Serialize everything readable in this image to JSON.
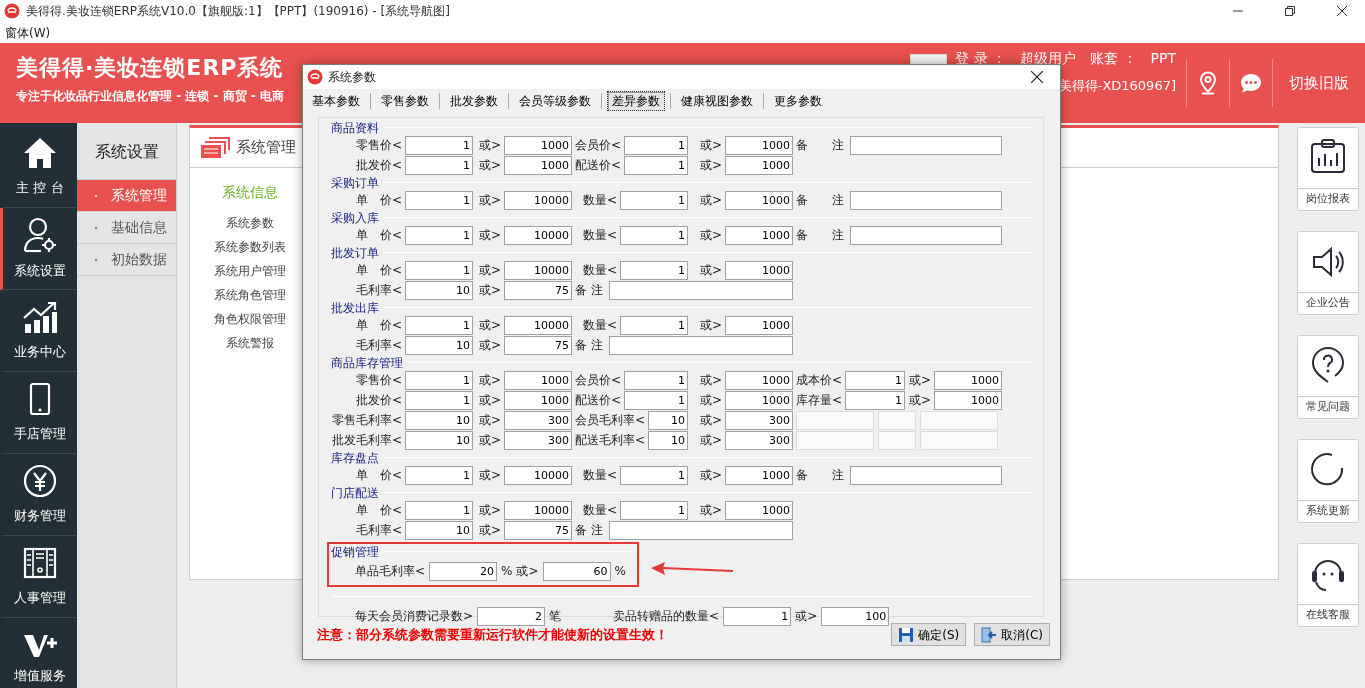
{
  "window": {
    "title": "美得得.美妆连锁ERP系统V10.0【旗舰版:1】【PPT】(190916) - [系统导航图]",
    "menu": [
      "窗体(W)"
    ]
  },
  "header": {
    "brand": "美得得·美妆连锁ERP系统",
    "slogan": "专注于化妆品行业信息化管理 - 连锁 - 商贸 - 电商",
    "login_label": "登 录 ：",
    "user": "超级用户",
    "account_label": "账套 ：",
    "account": "PPT",
    "account_code": "美得得-XD160967]",
    "switch_label": "切换旧版"
  },
  "nav": [
    {
      "label": "主 控 台",
      "selected": false
    },
    {
      "label": "系统设置",
      "selected": true
    },
    {
      "label": "业务中心",
      "selected": false
    },
    {
      "label": "手店管理",
      "selected": false
    },
    {
      "label": "财务管理",
      "selected": false
    },
    {
      "label": "人事管理",
      "selected": false
    },
    {
      "label": "增值服务",
      "selected": false
    }
  ],
  "submenu": {
    "title": "系统设置",
    "items": [
      {
        "label": "系统管理",
        "selected": true
      },
      {
        "label": "基础信息",
        "selected": false
      },
      {
        "label": "初始数据",
        "selected": false
      }
    ]
  },
  "panel": {
    "title": "系统管理",
    "group": "系统信息",
    "links": [
      "系统参数",
      "系统参数列表",
      "系统用户管理",
      "系统角色管理",
      "角色权限管理",
      "系统警报"
    ]
  },
  "shortcuts": [
    "岗位报表",
    "企业公告",
    "常见问题",
    "系统更新",
    "在线客服"
  ],
  "dialog": {
    "title": "系统参数",
    "tabs": [
      {
        "label": "基本参数",
        "selected": false
      },
      {
        "label": "零售参数",
        "selected": false
      },
      {
        "label": "批发参数",
        "selected": false
      },
      {
        "label": "会员等级参数",
        "selected": false
      },
      {
        "label": "差异参数",
        "selected": true
      },
      {
        "label": "健康视图参数",
        "selected": false
      },
      {
        "label": "更多参数",
        "selected": false
      }
    ],
    "sections": [
      {
        "title": "商品资料",
        "highlighted": false,
        "rows": [
          [
            {
              "kind": "pair",
              "label": "零售价<",
              "value": "1"
            },
            {
              "kind": "pair",
              "label": "或>",
              "value": "1000"
            },
            {
              "kind": "pair",
              "label": "会员价<",
              "value": "1"
            },
            {
              "kind": "pair",
              "label": "或>",
              "value": "1000"
            },
            {
              "kind": "note",
              "label": "备　　注"
            }
          ],
          [
            {
              "kind": "pair",
              "label": "批发价<",
              "value": "1"
            },
            {
              "kind": "pair",
              "label": "或>",
              "value": "1000"
            },
            {
              "kind": "pair",
              "label": "配送价<",
              "value": "1"
            },
            {
              "kind": "pair",
              "label": "或>",
              "value": "1000"
            }
          ]
        ]
      },
      {
        "title": "采购订单",
        "highlighted": false,
        "rows": [
          [
            {
              "kind": "pair",
              "label": "单　价<",
              "value": "1"
            },
            {
              "kind": "pair",
              "label": "或>",
              "value": "10000"
            },
            {
              "kind": "pair",
              "label": "数量<",
              "value": "1"
            },
            {
              "kind": "pair",
              "label": "或>",
              "value": "1000"
            },
            {
              "kind": "note",
              "label": "备　　注"
            }
          ]
        ]
      },
      {
        "title": "采购入库",
        "highlighted": false,
        "rows": [
          [
            {
              "kind": "pair",
              "label": "单　价<",
              "value": "1"
            },
            {
              "kind": "pair",
              "label": "或>",
              "value": "10000"
            },
            {
              "kind": "pair",
              "label": "数量<",
              "value": "1"
            },
            {
              "kind": "pair",
              "label": "或>",
              "value": "1000"
            },
            {
              "kind": "note",
              "label": "备　　注"
            }
          ]
        ]
      },
      {
        "title": "批发订单",
        "highlighted": false,
        "rows": [
          [
            {
              "kind": "pair",
              "label": "单　价<",
              "value": "1"
            },
            {
              "kind": "pair",
              "label": "或>",
              "value": "10000"
            },
            {
              "kind": "pair",
              "label": "数量<",
              "value": "1"
            },
            {
              "kind": "pair",
              "label": "或>",
              "value": "1000"
            }
          ],
          [
            {
              "kind": "pair",
              "label": "毛利率<",
              "value": "10"
            },
            {
              "kind": "pair",
              "label": "或>",
              "value": "75"
            },
            {
              "kind": "note",
              "label": "备 注"
            }
          ]
        ]
      },
      {
        "title": "批发出库",
        "highlighted": false,
        "rows": [
          [
            {
              "kind": "pair",
              "label": "单　价<",
              "value": "1"
            },
            {
              "kind": "pair",
              "label": "或>",
              "value": "10000"
            },
            {
              "kind": "pair",
              "label": "数量<",
              "value": "1"
            },
            {
              "kind": "pair",
              "label": "或>",
              "value": "1000"
            }
          ],
          [
            {
              "kind": "pair",
              "label": "毛利率<",
              "value": "10"
            },
            {
              "kind": "pair",
              "label": "或>",
              "value": "75"
            },
            {
              "kind": "note",
              "label": "备 注"
            }
          ]
        ]
      },
      {
        "title": "商品库存管理",
        "highlighted": false,
        "rows": [
          [
            {
              "kind": "pair",
              "label": "零售价<",
              "value": "1"
            },
            {
              "kind": "pair",
              "label": "或>",
              "value": "1000"
            },
            {
              "kind": "pair",
              "label": "会员价<",
              "value": "1"
            },
            {
              "kind": "pair",
              "label": "或>",
              "value": "1000"
            },
            {
              "kind": "pair",
              "label": "成本价<",
              "value": "1"
            },
            {
              "kind": "pair",
              "label": "或>",
              "value": "1000"
            }
          ],
          [
            {
              "kind": "pair",
              "label": "批发价<",
              "value": "1"
            },
            {
              "kind": "pair",
              "label": "或>",
              "value": "1000"
            },
            {
              "kind": "pair",
              "label": "配送价<",
              "value": "1"
            },
            {
              "kind": "pair",
              "label": "或>",
              "value": "1000"
            },
            {
              "kind": "pair",
              "label": "库存量<",
              "value": "1"
            },
            {
              "kind": "pair",
              "label": "或>",
              "value": "1000"
            }
          ],
          [
            {
              "kind": "pair",
              "label": "零售毛利率<",
              "value": "10"
            },
            {
              "kind": "pair",
              "label": "或>",
              "value": "300"
            },
            {
              "kind": "pair",
              "label": "会员毛利率<",
              "value": "10"
            },
            {
              "kind": "pair",
              "label": "或>",
              "value": "300"
            },
            {
              "kind": "blank"
            }
          ],
          [
            {
              "kind": "pair",
              "label": "批发毛利率<",
              "value": "10"
            },
            {
              "kind": "pair",
              "label": "或>",
              "value": "300"
            },
            {
              "kind": "pair",
              "label": "配送毛利率<",
              "value": "10"
            },
            {
              "kind": "pair",
              "label": "或>",
              "value": "300"
            },
            {
              "kind": "blank"
            }
          ]
        ]
      },
      {
        "title": "库存盘点",
        "highlighted": false,
        "rows": [
          [
            {
              "kind": "pair",
              "label": "单　价<",
              "value": "1"
            },
            {
              "kind": "pair",
              "label": "或>",
              "value": "10000"
            },
            {
              "kind": "pair",
              "label": "数量<",
              "value": "1"
            },
            {
              "kind": "pair",
              "label": "或>",
              "value": "1000"
            },
            {
              "kind": "note",
              "label": "备　　注"
            }
          ]
        ]
      },
      {
        "title": "门店配送",
        "highlighted": false,
        "rows": [
          [
            {
              "kind": "pair",
              "label": "单　价<",
              "value": "1"
            },
            {
              "kind": "pair",
              "label": "或>",
              "value": "10000"
            },
            {
              "kind": "pair",
              "label": "数量<",
              "value": "1"
            },
            {
              "kind": "pair",
              "label": "或>",
              "value": "1000"
            }
          ],
          [
            {
              "kind": "pair",
              "label": "毛利率<",
              "value": "10"
            },
            {
              "kind": "pair",
              "label": "或>",
              "value": "75"
            },
            {
              "kind": "note",
              "label": "备 注"
            }
          ]
        ]
      },
      {
        "title": "促销管理",
        "highlighted": true,
        "inline": [
          [
            {
              "kind": "text",
              "text": "单品毛利率<"
            },
            {
              "kind": "field",
              "value": "20"
            },
            {
              "kind": "text",
              "text": "%"
            },
            {
              "kind": "text",
              "text": "或>"
            },
            {
              "kind": "field",
              "value": "60"
            },
            {
              "kind": "text",
              "text": "%"
            }
          ]
        ]
      },
      {
        "highlighted": false,
        "inline": [
          [
            {
              "kind": "text",
              "text": "每天会员消费记录数>"
            },
            {
              "kind": "field",
              "value": "2"
            },
            {
              "kind": "text",
              "text": "笔"
            }
          ],
          [
            {
              "kind": "text",
              "text": "卖品转赠品的数量<"
            },
            {
              "kind": "field",
              "value": "1"
            },
            {
              "kind": "text",
              "text": "或>"
            },
            {
              "kind": "field",
              "value": "100"
            }
          ]
        ]
      }
    ],
    "notice": "注意：部分系统参数需要重新运行软件才能使新的设置生效！",
    "buttons": [
      "确定(S)",
      "取消(C)"
    ]
  }
}
